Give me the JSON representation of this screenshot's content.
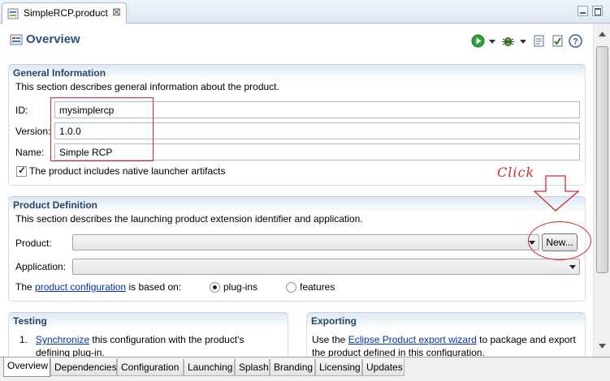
{
  "editor_tab": {
    "title": "SimpleRCP.product",
    "close_glyph": "⊠"
  },
  "header": {
    "title": "Overview"
  },
  "general": {
    "title": "General Information",
    "description": "This section describes general information about the product.",
    "id_label": "ID:",
    "id_value": "mysimplercp",
    "version_label": "Version:",
    "version_value": "1.0.0",
    "name_label": "Name:",
    "name_value": "Simple RCP",
    "native_launcher_label": "The product includes native launcher artifacts"
  },
  "definition": {
    "title": "Product Definition",
    "description": "This section describes the launching product extension identifier and application.",
    "product_label": "Product:",
    "new_button": "New...",
    "application_label": "Application:",
    "config_prefix": "The",
    "config_link": "product configuration",
    "config_suffix": "is based on:",
    "opt_plugins": "plug-ins",
    "opt_features": "features"
  },
  "testing": {
    "title": "Testing",
    "item_num": "1.",
    "item_link": "Synchronize",
    "item_text": "this configuration with the product's",
    "item_text2": "defining plug-in."
  },
  "exporting": {
    "title": "Exporting",
    "text_prefix": "Use the",
    "link": "Eclipse Product export wizard",
    "text_suffix": "to package and export",
    "text2": "the product defined in this configuration."
  },
  "annotation": {
    "text": "Click"
  },
  "bottom_tabs": [
    "Overview",
    "Dependencies",
    "Configuration",
    "Launching",
    "Splash",
    "Branding",
    "Licensing",
    "Updates"
  ],
  "colors": {
    "header_title": "#2e4f76",
    "section_title": "#27466b",
    "annotation": "#d62828",
    "link": "#0033aa"
  },
  "icons": [
    "product-file-icon",
    "close-icon",
    "minimize-icon",
    "maximize-icon",
    "overview-icon",
    "run-icon",
    "debug-icon",
    "export-icon",
    "validate-icon",
    "help-icon"
  ]
}
